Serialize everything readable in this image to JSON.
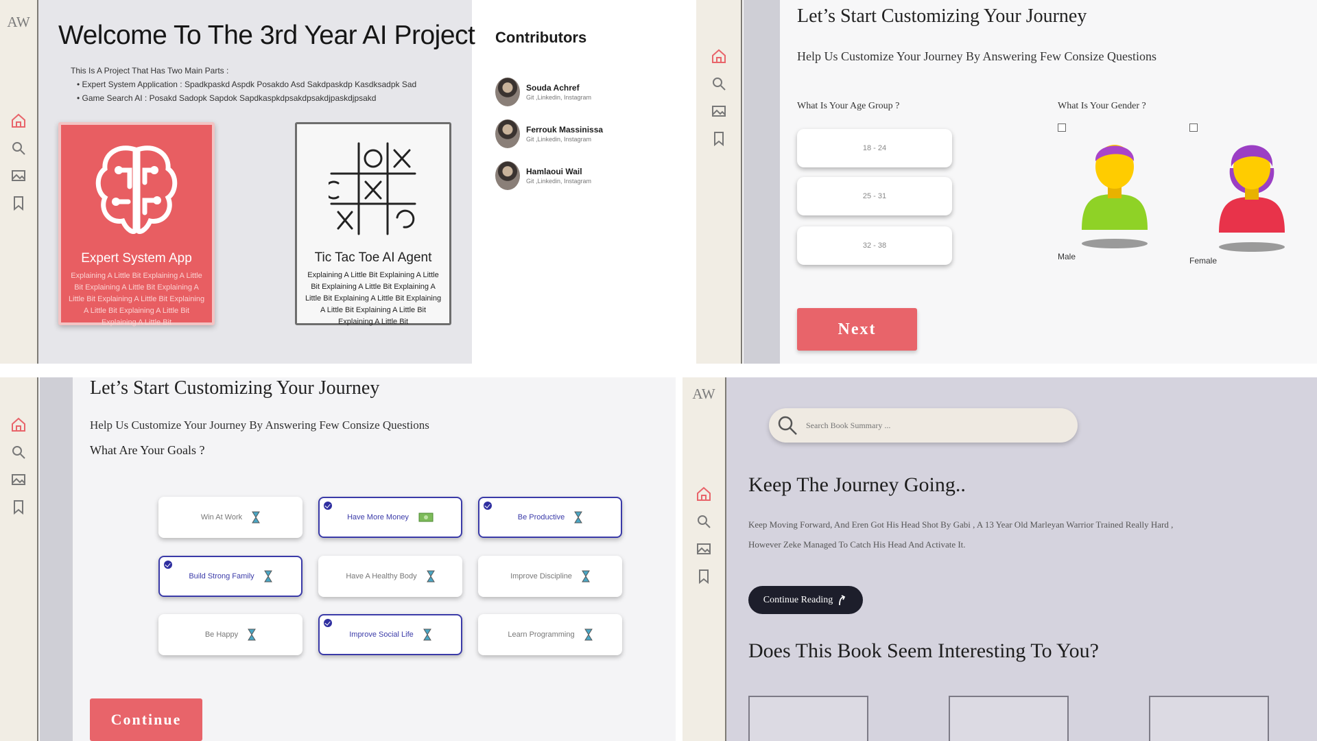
{
  "panel1": {
    "logo": "AW",
    "title": "Welcome To The 3rd Year AI Project",
    "intro": "This Is A Project That Has Two Main Parts :",
    "parts": [
      "Expert System Application : Spadkpaskd Aspdk Posakdo Asd Sakdpaskdp Kasdksadpk Sad",
      "Game Search AI : Posakd Sadopk Sapdok Sapdkaspkdpsakdpsakdjpaskdjpsakd"
    ],
    "cards": [
      {
        "title": "Expert System App",
        "desc": "Explaining A Little Bit Explaining A Little Bit Explaining A Little Bit Explaining A Little Bit Explaining A Little Bit Explaining A Little Bit Explaining A Little Bit Explaining A Little Bit"
      },
      {
        "title": "Tic Tac Toe AI Agent",
        "desc": "Explaining A Little Bit Explaining A Little Bit Explaining A Little Bit Explaining A Little Bit Explaining A Little Bit Explaining A Little Bit Explaining A Little Bit Explaining A Little Bit"
      }
    ],
    "contributors_title": "Contributors",
    "contributors": [
      {
        "name": "Souda Achref",
        "links": "Git ,Linkedin, Instagram"
      },
      {
        "name": "Ferrouk Massinissa",
        "links": "Git ,Linkedin, Instagram"
      },
      {
        "name": "Hamlaoui Wail",
        "links": "Git ,Linkedin, Instagram"
      }
    ]
  },
  "panel2": {
    "heading": "Let’s Start Customizing Your Journey",
    "subheading": "Help Us Customize Your Journey By Answering Few Consize Questions",
    "age_question": "What Is Your Age Group ?",
    "gender_question": "What Is Your Gender ?",
    "age_options": [
      "18 - 24",
      "25 - 31",
      "32 - 38"
    ],
    "genders": [
      "Male",
      "Female"
    ],
    "next_label": "Next"
  },
  "panel3": {
    "heading": "Let’s Start Customizing Your Journey",
    "subheading": "Help Us Customize Your Journey By Answering Few Consize Questions",
    "question": "What Are Your Goals ?",
    "goals": [
      {
        "label": "Win At Work",
        "selected": false
      },
      {
        "label": "Have More Money",
        "selected": true
      },
      {
        "label": "Be Productive",
        "selected": true
      },
      {
        "label": "Build Strong Family",
        "selected": true
      },
      {
        "label": "Have A Healthy Body",
        "selected": false
      },
      {
        "label": "Improve Discipline",
        "selected": false
      },
      {
        "label": "Be Happy",
        "selected": false
      },
      {
        "label": "Improve Social Life",
        "selected": true
      },
      {
        "label": "Learn Programming",
        "selected": false
      }
    ],
    "continue_label": "Continue"
  },
  "panel4": {
    "logo": "AW",
    "search_placeholder": "Search Book Summary ...",
    "heading": "Keep The Journey Going..",
    "paragraph": "Keep Moving Forward, And Eren Got His Head Shot By Gabi , A 13 Year Old Marleyan Warrior Trained Really Hard , However Zeke Managed To Catch His Head And Activate It.",
    "continue_reading": "Continue Reading",
    "question": "Does This Book Seem Interesting To You?"
  },
  "colors": {
    "accent": "#e8646a",
    "selected": "#3a3aa8",
    "home_icon": "#e8646a",
    "dark_button": "#1d1e2b"
  },
  "icons": [
    "home-icon",
    "search-icon",
    "image-icon",
    "bookmark-icon"
  ]
}
